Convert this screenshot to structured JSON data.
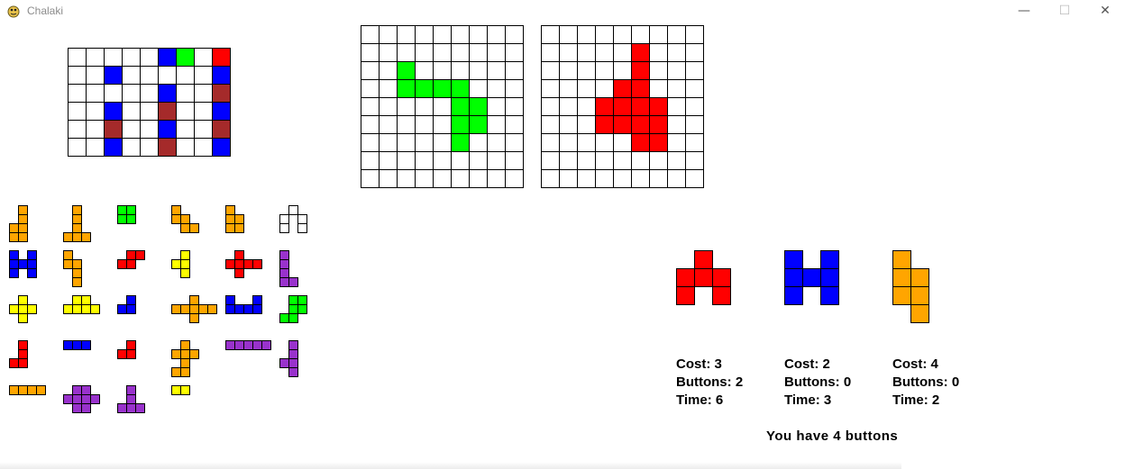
{
  "window": {
    "title": "Chalaki",
    "minimize": "—",
    "maximize": "☐",
    "close": "✕"
  },
  "colors": {
    "blue": "#0000ff",
    "green": "#00ff00",
    "red": "#ff0000",
    "brown": "#a52a2a",
    "orange": "#ffa500",
    "yellow": "#ffff00",
    "purple": "#9932cc",
    "white": "#ffffff"
  },
  "board": {
    "rows": 6,
    "cols": 9,
    "filled": [
      [
        0,
        5,
        "blue"
      ],
      [
        0,
        6,
        "green"
      ],
      [
        0,
        8,
        "red"
      ],
      [
        1,
        2,
        "blue"
      ],
      [
        1,
        8,
        "blue"
      ],
      [
        2,
        5,
        "blue"
      ],
      [
        2,
        8,
        "brown"
      ],
      [
        3,
        2,
        "blue"
      ],
      [
        3,
        5,
        "brown"
      ],
      [
        3,
        8,
        "blue"
      ],
      [
        4,
        2,
        "brown"
      ],
      [
        4,
        5,
        "blue"
      ],
      [
        4,
        8,
        "brown"
      ],
      [
        5,
        2,
        "blue"
      ],
      [
        5,
        5,
        "brown"
      ],
      [
        5,
        8,
        "blue"
      ]
    ]
  },
  "targets": [
    {
      "rows": 9,
      "cols": 9,
      "color": "green",
      "cells": [
        [
          2,
          2
        ],
        [
          3,
          2
        ],
        [
          3,
          3
        ],
        [
          3,
          4
        ],
        [
          3,
          5
        ],
        [
          4,
          5
        ],
        [
          4,
          6
        ],
        [
          5,
          5
        ],
        [
          5,
          6
        ],
        [
          6,
          5
        ]
      ]
    },
    {
      "rows": 9,
      "cols": 9,
      "color": "red",
      "cells": [
        [
          1,
          5
        ],
        [
          2,
          5
        ],
        [
          3,
          4
        ],
        [
          3,
          5
        ],
        [
          4,
          3
        ],
        [
          4,
          4
        ],
        [
          4,
          5
        ],
        [
          4,
          6
        ],
        [
          5,
          3
        ],
        [
          5,
          4
        ],
        [
          5,
          5
        ],
        [
          5,
          6
        ],
        [
          6,
          5
        ],
        [
          6,
          6
        ]
      ]
    }
  ],
  "inventory": [
    {
      "color": "orange",
      "cells": [
        [
          0,
          1
        ],
        [
          1,
          1
        ],
        [
          2,
          0
        ],
        [
          2,
          1
        ],
        [
          3,
          0
        ],
        [
          3,
          1
        ]
      ]
    },
    {
      "color": "orange",
      "cells": [
        [
          0,
          1
        ],
        [
          1,
          1
        ],
        [
          2,
          1
        ],
        [
          3,
          0
        ],
        [
          3,
          1
        ],
        [
          3,
          2
        ]
      ]
    },
    {
      "color": "green",
      "cells": [
        [
          0,
          0
        ],
        [
          0,
          1
        ],
        [
          1,
          0
        ],
        [
          1,
          1
        ]
      ]
    },
    {
      "color": "orange",
      "cells": [
        [
          0,
          0
        ],
        [
          1,
          0
        ],
        [
          1,
          1
        ],
        [
          2,
          1
        ],
        [
          2,
          2
        ]
      ]
    },
    {
      "color": "orange",
      "cells": [
        [
          0,
          0
        ],
        [
          1,
          0
        ],
        [
          1,
          1
        ],
        [
          2,
          0
        ],
        [
          2,
          1
        ]
      ]
    },
    {
      "color": "white",
      "cells": [
        [
          0,
          1
        ],
        [
          1,
          0
        ],
        [
          1,
          2
        ],
        [
          2,
          0
        ],
        [
          2,
          2
        ]
      ]
    },
    {
      "color": "blue",
      "cells": [
        [
          0,
          0
        ],
        [
          0,
          2
        ],
        [
          1,
          0
        ],
        [
          1,
          1
        ],
        [
          1,
          2
        ],
        [
          2,
          0
        ],
        [
          2,
          2
        ]
      ]
    },
    {
      "color": "orange",
      "cells": [
        [
          0,
          0
        ],
        [
          1,
          0
        ],
        [
          1,
          1
        ],
        [
          2,
          1
        ],
        [
          3,
          1
        ]
      ]
    },
    {
      "color": "red",
      "cells": [
        [
          0,
          1
        ],
        [
          0,
          2
        ],
        [
          1,
          0
        ],
        [
          1,
          1
        ]
      ]
    },
    {
      "color": "yellow",
      "cells": [
        [
          0,
          1
        ],
        [
          1,
          0
        ],
        [
          1,
          1
        ],
        [
          2,
          1
        ]
      ]
    },
    {
      "color": "red",
      "cells": [
        [
          0,
          1
        ],
        [
          1,
          0
        ],
        [
          1,
          1
        ],
        [
          1,
          2
        ],
        [
          1,
          3
        ],
        [
          2,
          1
        ]
      ]
    },
    {
      "color": "purple",
      "cells": [
        [
          0,
          0
        ],
        [
          1,
          0
        ],
        [
          2,
          0
        ],
        [
          3,
          0
        ],
        [
          3,
          1
        ]
      ]
    },
    {
      "color": "yellow",
      "cells": [
        [
          0,
          1
        ],
        [
          1,
          0
        ],
        [
          1,
          1
        ],
        [
          1,
          2
        ],
        [
          2,
          1
        ]
      ]
    },
    {
      "color": "yellow",
      "cells": [
        [
          0,
          1
        ],
        [
          0,
          2
        ],
        [
          1,
          0
        ],
        [
          1,
          1
        ],
        [
          1,
          2
        ],
        [
          1,
          3
        ]
      ]
    },
    {
      "color": "blue",
      "cells": [
        [
          0,
          1
        ],
        [
          1,
          0
        ],
        [
          1,
          1
        ]
      ]
    },
    {
      "color": "orange",
      "cells": [
        [
          0,
          2
        ],
        [
          1,
          0
        ],
        [
          1,
          1
        ],
        [
          1,
          2
        ],
        [
          1,
          3
        ],
        [
          1,
          4
        ],
        [
          2,
          2
        ]
      ]
    },
    {
      "color": "blue",
      "cells": [
        [
          0,
          0
        ],
        [
          0,
          3
        ],
        [
          1,
          0
        ],
        [
          1,
          1
        ],
        [
          1,
          2
        ],
        [
          1,
          3
        ]
      ]
    },
    {
      "color": "green",
      "cells": [
        [
          0,
          1
        ],
        [
          0,
          2
        ],
        [
          1,
          1
        ],
        [
          1,
          2
        ],
        [
          2,
          0
        ],
        [
          2,
          1
        ]
      ]
    },
    {
      "color": "red",
      "cells": [
        [
          0,
          1
        ],
        [
          1,
          1
        ],
        [
          2,
          0
        ],
        [
          2,
          1
        ]
      ]
    },
    {
      "color": "blue",
      "cells": [
        [
          0,
          0
        ],
        [
          0,
          1
        ],
        [
          0,
          2
        ]
      ]
    },
    {
      "color": "red",
      "cells": [
        [
          0,
          1
        ],
        [
          1,
          0
        ],
        [
          1,
          1
        ]
      ]
    },
    {
      "color": "orange",
      "cells": [
        [
          0,
          1
        ],
        [
          1,
          0
        ],
        [
          1,
          1
        ],
        [
          1,
          2
        ],
        [
          2,
          1
        ],
        [
          3,
          0
        ],
        [
          3,
          1
        ]
      ]
    },
    {
      "color": "purple",
      "cells": [
        [
          0,
          0
        ],
        [
          0,
          1
        ],
        [
          0,
          2
        ],
        [
          0,
          3
        ],
        [
          0,
          4
        ]
      ]
    },
    {
      "color": "purple",
      "cells": [
        [
          0,
          1
        ],
        [
          1,
          1
        ],
        [
          2,
          0
        ],
        [
          2,
          1
        ],
        [
          3,
          1
        ]
      ]
    },
    {
      "color": "orange",
      "cells": [
        [
          0,
          0
        ],
        [
          0,
          1
        ],
        [
          0,
          2
        ],
        [
          0,
          3
        ]
      ]
    },
    {
      "color": "purple",
      "cells": [
        [
          0,
          1
        ],
        [
          0,
          2
        ],
        [
          1,
          0
        ],
        [
          1,
          1
        ],
        [
          1,
          2
        ],
        [
          1,
          3
        ],
        [
          2,
          1
        ],
        [
          2,
          2
        ]
      ]
    },
    {
      "color": "purple",
      "cells": [
        [
          0,
          1
        ],
        [
          1,
          1
        ],
        [
          2,
          0
        ],
        [
          2,
          1
        ],
        [
          2,
          2
        ]
      ]
    },
    {
      "color": "yellow",
      "cells": [
        [
          0,
          0
        ],
        [
          0,
          1
        ]
      ]
    }
  ],
  "choices": [
    {
      "color": "red",
      "cells": [
        [
          0,
          1
        ],
        [
          1,
          0
        ],
        [
          1,
          1
        ],
        [
          1,
          2
        ],
        [
          2,
          0
        ],
        [
          2,
          2
        ]
      ],
      "cost": "Cost: 3",
      "buttons": "Buttons: 2",
      "time": "Time: 6"
    },
    {
      "color": "blue",
      "cells": [
        [
          0,
          0
        ],
        [
          0,
          2
        ],
        [
          1,
          0
        ],
        [
          1,
          1
        ],
        [
          1,
          2
        ],
        [
          2,
          0
        ],
        [
          2,
          2
        ]
      ],
      "cost": "Cost: 2",
      "buttons": "Buttons: 0",
      "time": "Time: 3"
    },
    {
      "color": "orange",
      "cells": [
        [
          0,
          0
        ],
        [
          1,
          0
        ],
        [
          1,
          1
        ],
        [
          2,
          0
        ],
        [
          2,
          1
        ],
        [
          3,
          1
        ]
      ],
      "cost": "Cost: 4",
      "buttons": "Buttons: 0",
      "time": "Time: 2"
    }
  ],
  "status": {
    "buttons_text": "You have 4 buttons"
  }
}
